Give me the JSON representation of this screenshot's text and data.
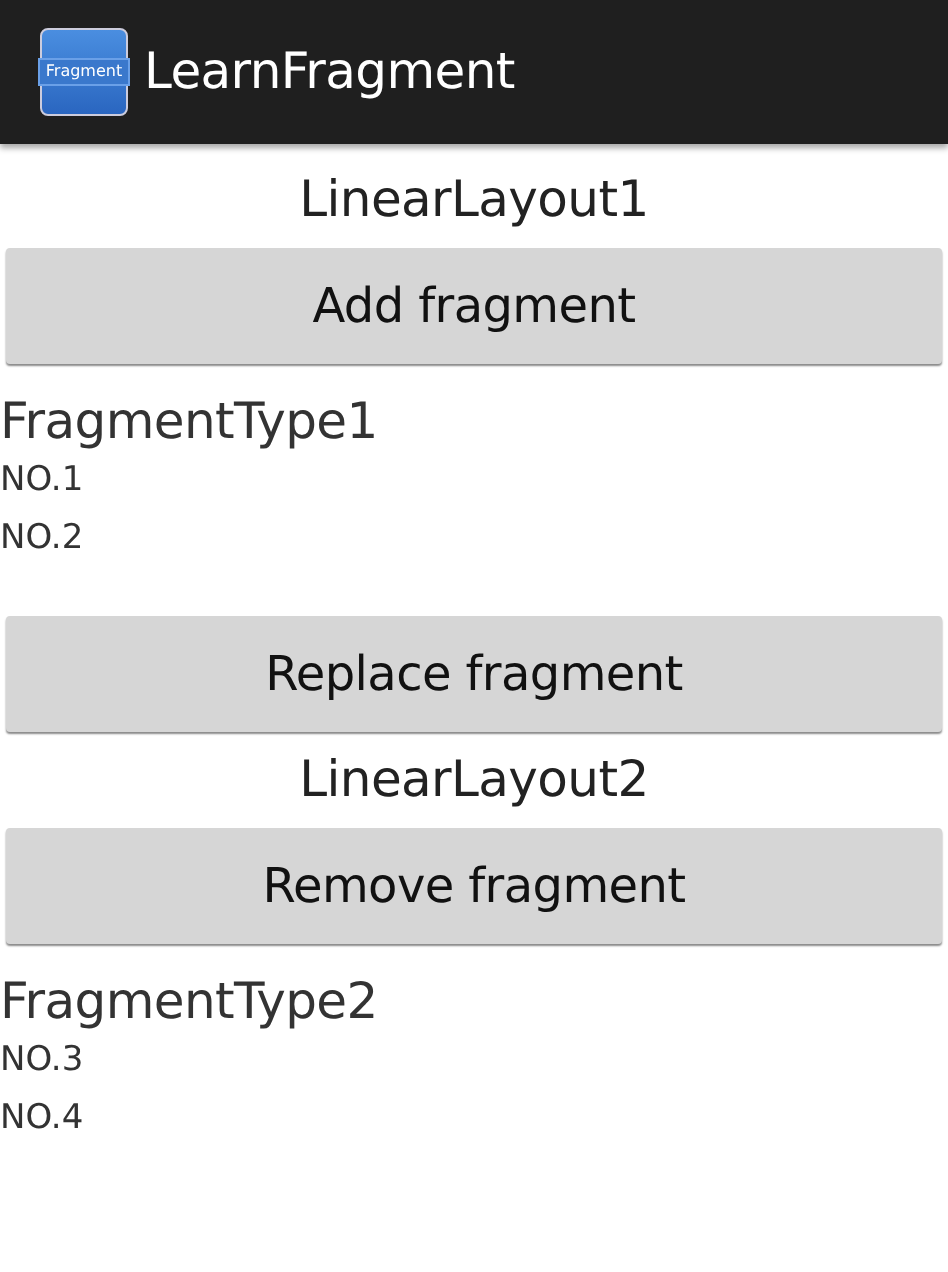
{
  "action_bar": {
    "icon_label": "Fragment",
    "title": "LearnFragment"
  },
  "content": [
    {
      "kind": "heading",
      "text": "LinearLayout1"
    },
    {
      "kind": "button",
      "text": "Add fragment"
    },
    {
      "kind": "fragment",
      "title": "FragmentType1",
      "lines": [
        "NO.1",
        "NO.2"
      ]
    },
    {
      "kind": "button",
      "text": "Replace fragment"
    },
    {
      "kind": "heading",
      "text": "LinearLayout2"
    },
    {
      "kind": "button",
      "text": "Remove fragment"
    },
    {
      "kind": "fragment",
      "title": "FragmentType2",
      "lines": [
        "NO.3",
        "NO.4"
      ]
    }
  ]
}
